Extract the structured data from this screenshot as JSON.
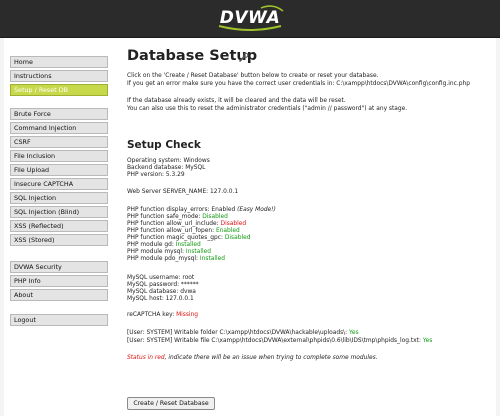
{
  "header": {
    "logo_text": "DVWA"
  },
  "sidebar": {
    "group1": [
      {
        "label": "Home",
        "selected": false
      },
      {
        "label": "Instructions",
        "selected": false
      },
      {
        "label": "Setup / Reset DB",
        "selected": true
      }
    ],
    "group2": [
      {
        "label": "Brute Force"
      },
      {
        "label": "Command Injection"
      },
      {
        "label": "CSRF"
      },
      {
        "label": "File Inclusion"
      },
      {
        "label": "File Upload"
      },
      {
        "label": "Insecure CAPTCHA"
      },
      {
        "label": "SQL Injection"
      },
      {
        "label": "SQL Injection (Blind)"
      },
      {
        "label": "XSS (Reflected)"
      },
      {
        "label": "XSS (Stored)"
      }
    ],
    "group3": [
      {
        "label": "DVWA Security"
      },
      {
        "label": "PHP Info"
      },
      {
        "label": "About"
      }
    ],
    "group4": [
      {
        "label": "Logout"
      }
    ]
  },
  "main": {
    "title": "Database Setup",
    "intro1": "Click on the 'Create / Reset Database' button below to create or reset your database.",
    "intro2": "If you get an error make sure you have the correct user credentials in: C:\\xampp\\htdocs\\DVWA\\config\\config.inc.php",
    "intro3": "If the database already exists, it will be cleared and the data will be reset.",
    "intro4": "You can also use this to reset the administrator credentials (\"admin // password\") at any stage.",
    "setup_check_title": "Setup Check",
    "os_line": "Operating system: Windows",
    "backend_line": "Backend database: MySQL",
    "php_version_line": "PHP version: 5.3.29",
    "server_name_line": "Web Server SERVER_NAME: 127.0.0.1",
    "php_funcs": [
      {
        "label": "PHP function display_errors: ",
        "value": "Enabled",
        "extra": " (Easy Mode!)",
        "status": "plain"
      },
      {
        "label": "PHP function safe_mode: ",
        "value": "Disabled",
        "status": "ok"
      },
      {
        "label": "PHP function allow_url_include: ",
        "value": "Disabled",
        "status": "bad"
      },
      {
        "label": "PHP function allow_url_fopen: ",
        "value": "Enabled",
        "status": "ok"
      },
      {
        "label": "PHP function magic_quotes_gpc: ",
        "value": "Disabled",
        "status": "ok"
      },
      {
        "label": "PHP module gd: ",
        "value": "Installed",
        "status": "ok"
      },
      {
        "label": "PHP module mysql: ",
        "value": "Installed",
        "status": "ok"
      },
      {
        "label": "PHP module pdo_mysql: ",
        "value": "Installed",
        "status": "ok"
      }
    ],
    "mysql": [
      "MySQL username: root",
      "MySQL password: ******",
      "MySQL database: dvwa",
      "MySQL host: 127.0.0.1"
    ],
    "recaptcha_label": "reCAPTCHA key: ",
    "recaptcha_value": "Missing",
    "writable1_label": "[User: SYSTEM] Writable folder C:\\xampp\\htdocs\\DVWA\\hackable\\uploads\\: ",
    "writable1_value": "Yes",
    "writable2_label": "[User: SYSTEM] Writable file C:\\xampp\\htdocs\\DVWA\\external\\phpids\\0.6\\lib\\IDS\\tmp\\phpids_log.txt: ",
    "writable2_value": "Yes",
    "status_note_red": "Status in red",
    "status_note_rest": ", indicate there will be an issue when trying to complete some modules.",
    "button_label": "Create / Reset Database"
  },
  "colors": {
    "header_bg": "#2b2b2b",
    "selected_menu": "#c7d84a",
    "ok": "#119911",
    "bad": "#dd1111"
  }
}
